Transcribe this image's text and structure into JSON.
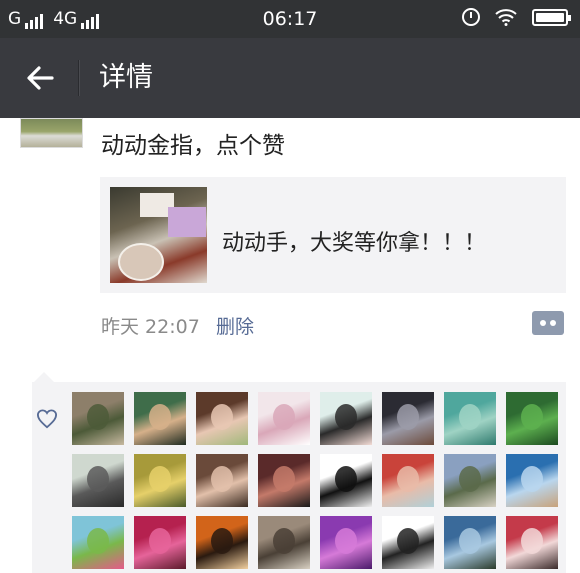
{
  "status_bar": {
    "carrier1": "G",
    "carrier2": "4G",
    "time": "06:17",
    "icons": [
      "signal-bars-icon",
      "signal-bars-icon",
      "alarm-icon",
      "wifi-icon",
      "battery-icon"
    ]
  },
  "nav": {
    "title": "详情",
    "back_icon": "arrow-left-icon"
  },
  "post": {
    "text": "动动金指，点个赞",
    "link_title": "动动手，大奖等你拿！！！",
    "time": "昨天 22:07",
    "delete_label": "删除",
    "comment_icon": "more-dots-icon"
  },
  "likes": {
    "icon": "heart-icon",
    "avatars": [
      {
        "name": "avatar-1",
        "colors": [
          "#8d7f6a",
          "#4c5a38",
          "#c7b9a0"
        ]
      },
      {
        "name": "avatar-2",
        "colors": [
          "#3f6d4a",
          "#d6b08a",
          "#1f2b20"
        ]
      },
      {
        "name": "avatar-3",
        "colors": [
          "#5c3a2a",
          "#e8c7b3",
          "#a0b87a"
        ]
      },
      {
        "name": "avatar-4",
        "colors": [
          "#f2e6ea",
          "#d9a7b8",
          "#ffffff"
        ]
      },
      {
        "name": "avatar-5",
        "colors": [
          "#dfeeea",
          "#2a2a2a",
          "#f3dcd6"
        ]
      },
      {
        "name": "avatar-6",
        "colors": [
          "#2b2b33",
          "#9b9ba8",
          "#6c4a3a"
        ]
      },
      {
        "name": "avatar-7",
        "colors": [
          "#4fa79d",
          "#9fd3c4",
          "#2f7a6e"
        ]
      },
      {
        "name": "avatar-8",
        "colors": [
          "#2e6b32",
          "#5db04f",
          "#1c4a20"
        ]
      },
      {
        "name": "avatar-9",
        "colors": [
          "#cfd8cf",
          "#5a5a5a",
          "#2a2a2a"
        ]
      },
      {
        "name": "avatar-10",
        "colors": [
          "#a79a3a",
          "#e6d06a",
          "#4a5a2a"
        ]
      },
      {
        "name": "avatar-11",
        "colors": [
          "#6a4a3a",
          "#e2c0aa",
          "#3a2a20"
        ]
      },
      {
        "name": "avatar-12",
        "colors": [
          "#5a2a2a",
          "#c47a6a",
          "#1a1a1a"
        ]
      },
      {
        "name": "avatar-13",
        "colors": [
          "#ffffff",
          "#111111",
          "#f0f0f0"
        ]
      },
      {
        "name": "avatar-14",
        "colors": [
          "#c9433a",
          "#e9bba8",
          "#b0d0d8"
        ]
      },
      {
        "name": "avatar-15",
        "colors": [
          "#8aa0c0",
          "#5a6a4a",
          "#d8d2c4"
        ]
      },
      {
        "name": "avatar-16",
        "colors": [
          "#2a6fb0",
          "#b9d6ee",
          "#c8a27a"
        ]
      },
      {
        "name": "avatar-17",
        "colors": [
          "#7fc4d8",
          "#7ab84a",
          "#e65a8a"
        ]
      },
      {
        "name": "avatar-18",
        "colors": [
          "#b5214f",
          "#e6649a",
          "#5a1a2a"
        ]
      },
      {
        "name": "avatar-19",
        "colors": [
          "#d2641a",
          "#2a1a10",
          "#f2d0a0"
        ]
      },
      {
        "name": "avatar-20",
        "colors": [
          "#9a8a7a",
          "#4a4036",
          "#d8d0c2"
        ]
      },
      {
        "name": "avatar-21",
        "colors": [
          "#8a3ab0",
          "#d67ad8",
          "#4a1a6a"
        ]
      },
      {
        "name": "avatar-22",
        "colors": [
          "#ffffff",
          "#222222",
          "#eeeeee"
        ]
      },
      {
        "name": "avatar-23",
        "colors": [
          "#3a6a9a",
          "#a8c8e0",
          "#2a3a2a"
        ]
      },
      {
        "name": "avatar-24",
        "colors": [
          "#c43a4a",
          "#f2d8d8",
          "#3a2a2a"
        ]
      }
    ]
  }
}
